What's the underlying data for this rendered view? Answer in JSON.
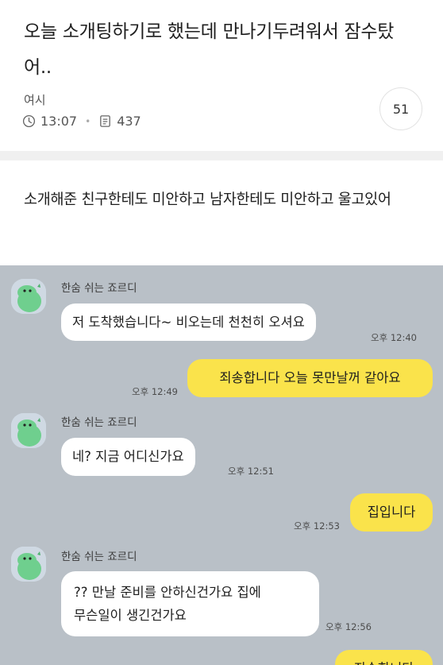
{
  "post": {
    "title": "오늘 소개팅하기로 했는데 만나기두려워서 잠수탔어..",
    "author": "여시",
    "time": "13:07",
    "views": "437",
    "comment_count": "51",
    "body": "소개해준 친구한테도 미안하고 남자한테도 미안하고 울고있어"
  },
  "icons": {
    "clock": "clock-icon",
    "views": "document-icon"
  },
  "colors": {
    "chat_background": "#b9c0c7",
    "outgoing_bubble": "#fae34b",
    "incoming_bubble": "#ffffff"
  },
  "chat": {
    "sender_name": "한숨 쉬는 죠르디",
    "messages": [
      {
        "dir": "in",
        "text": "저 도착했습니다~ 비오는데 천천히 오셔요",
        "time": "오후 12:40"
      },
      {
        "dir": "out",
        "text": "죄송합니다 오늘 못만날꺼 같아요",
        "time": "오후 12:49"
      },
      {
        "dir": "in",
        "text": "네? 지금 어디신가요",
        "time": "오후 12:51"
      },
      {
        "dir": "out",
        "text": "집입니다",
        "time": "오후 12:53"
      },
      {
        "dir": "in",
        "line1": "?? 만날 준비를 안하신건가요 집에",
        "line2": "무슨일이 생긴건가요",
        "time": "오후 12:56"
      },
      {
        "dir": "out",
        "text": "죄송합니다",
        "time": ""
      }
    ]
  }
}
